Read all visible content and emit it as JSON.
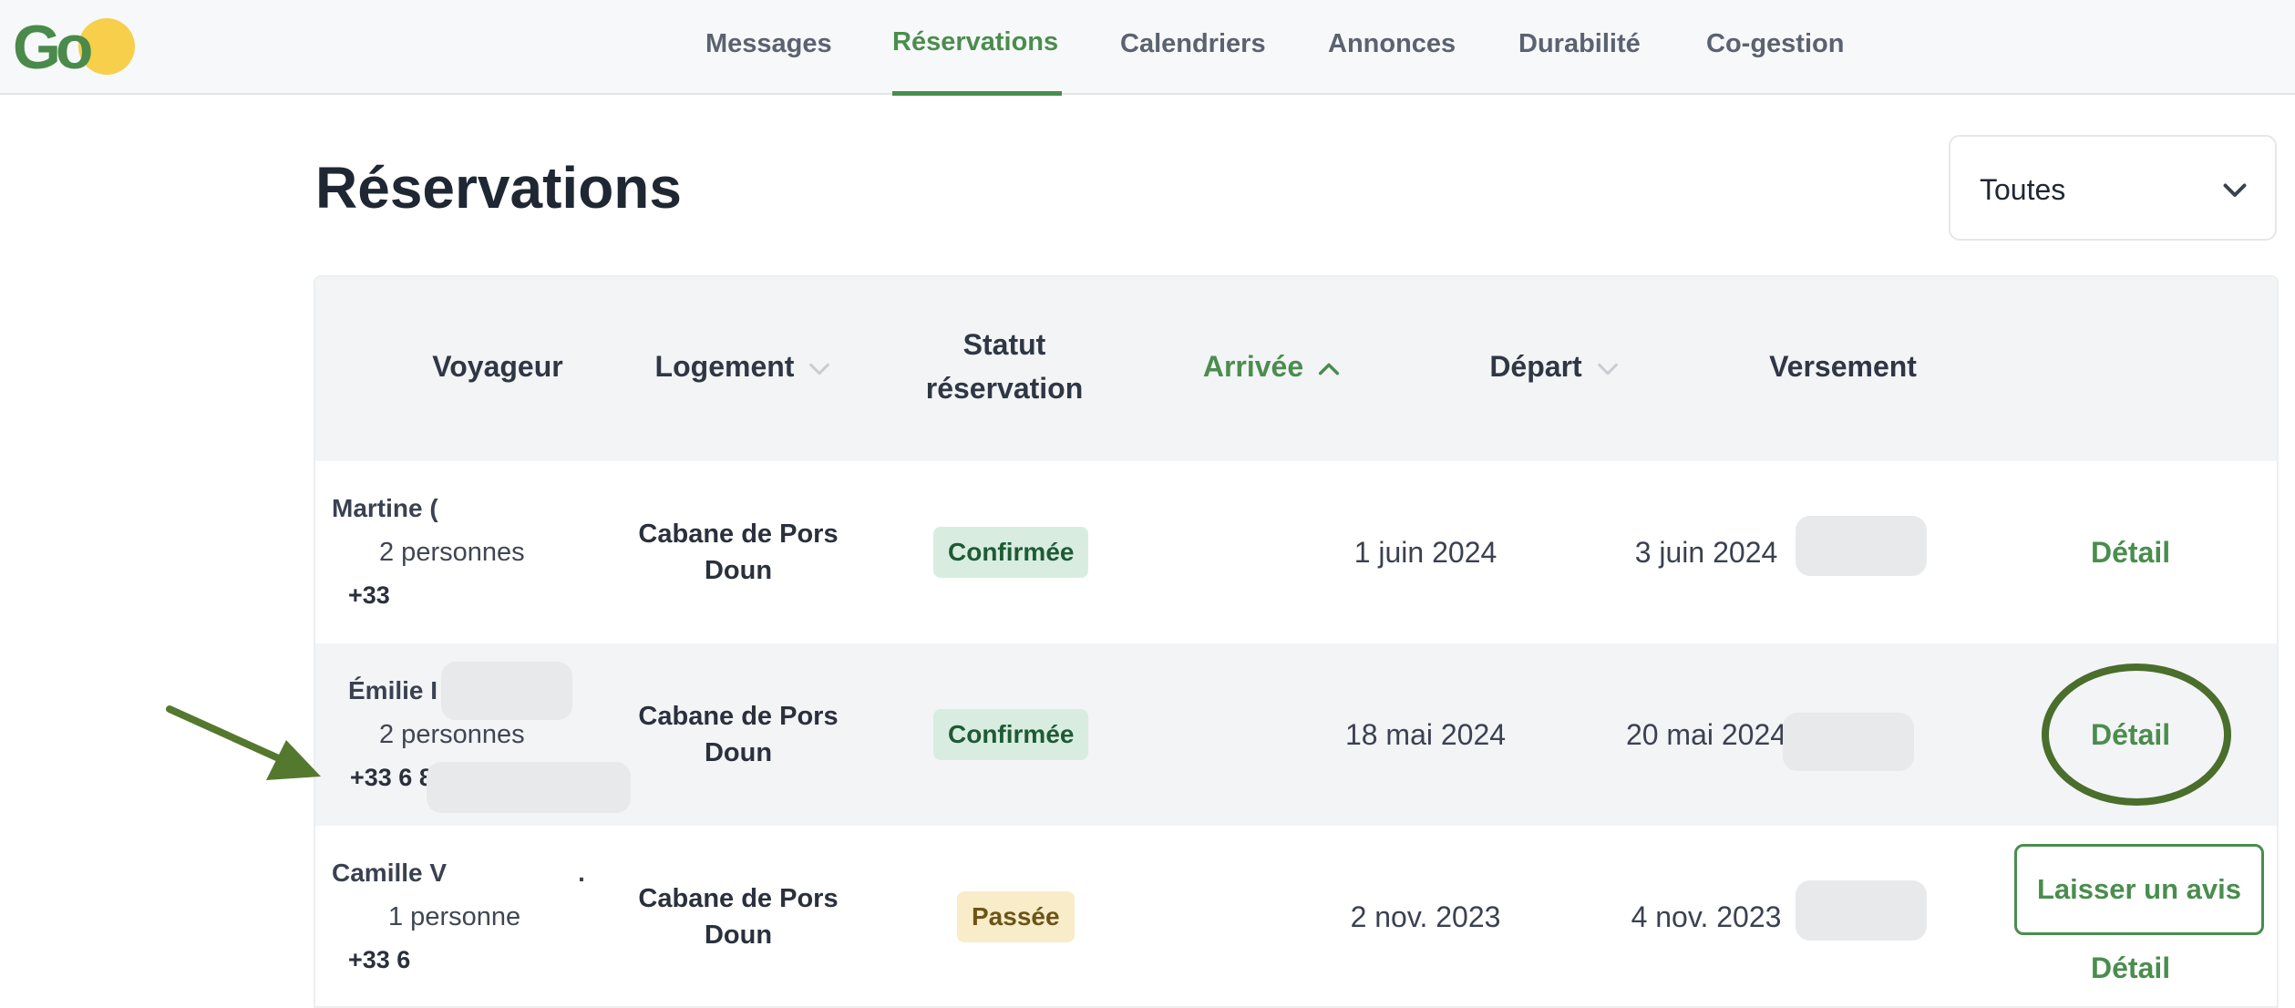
{
  "app": {
    "logo_text": "Go",
    "brand_colors": {
      "primary": "#4a8d4e",
      "sun": "#f7cf4a"
    }
  },
  "nav": {
    "items": [
      {
        "label": "Messages"
      },
      {
        "label": "Réservations",
        "active": true
      },
      {
        "label": "Calendriers"
      },
      {
        "label": "Annonces"
      },
      {
        "label": "Durabilité"
      },
      {
        "label": "Co-gestion"
      }
    ]
  },
  "page": {
    "title": "Réservations",
    "filter": {
      "selected": "Toutes",
      "icon": "chevron-down-icon"
    }
  },
  "table": {
    "headers": {
      "voyageur": "Voyageur",
      "logement": "Logement",
      "statut_line1": "Statut",
      "statut_line2": "réservation",
      "arrivee": "Arrivée",
      "depart": "Départ",
      "versement": "Versement"
    },
    "sort": {
      "column": "Arrivée",
      "direction": "ascending"
    },
    "rows": [
      {
        "guest_name": "Martine (",
        "guests": "2 personnes",
        "phone": "+33",
        "logement_line1": "Cabane de Pors",
        "logement_line2": "Doun",
        "status": "Confirmée",
        "status_type": "confirmed",
        "arrival": "1 juin 2024",
        "departure": "3 juin 2024",
        "payout_redacted": true,
        "actions": {
          "detail": "Détail"
        }
      },
      {
        "guest_name": "Émilie I",
        "guests": "2 personnes",
        "phone": "+33 6 8",
        "logement_line1": "Cabane de Pors",
        "logement_line2": "Doun",
        "status": "Confirmée",
        "status_type": "confirmed",
        "arrival": "18 mai 2024",
        "departure": "20 mai 2024",
        "payout_redacted": true,
        "actions": {
          "detail": "Détail"
        }
      },
      {
        "guest_name": "Camille V",
        "guest_name_suffix": ".",
        "guests": "1 personne",
        "phone": "+33 6",
        "logement_line1": "Cabane de Pors",
        "logement_line2": "Doun",
        "status": "Passée",
        "status_type": "past",
        "arrival": "2 nov. 2023",
        "departure": "4 nov. 2023",
        "payout_redacted": true,
        "actions": {
          "review": "Laisser un avis",
          "detail": "Détail"
        }
      }
    ]
  },
  "annotations": {
    "highlight_color": "#4a6e2b"
  }
}
